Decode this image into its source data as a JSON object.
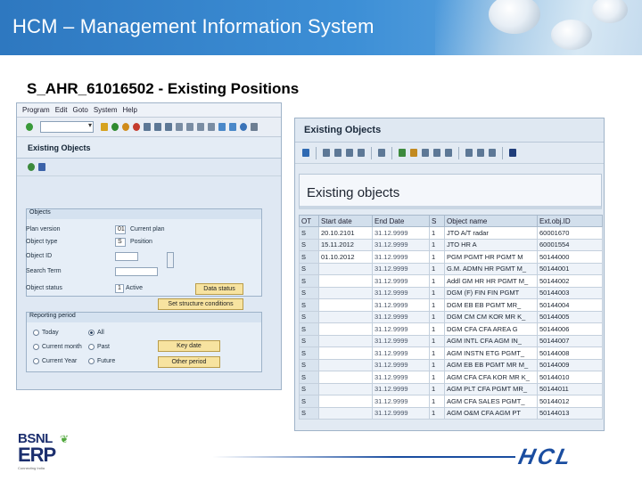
{
  "header": {
    "title": "HCM – Management Information System"
  },
  "slide": {
    "subtitle": "S_AHR_61016502 - Existing Positions"
  },
  "left_screen": {
    "menu": [
      "Program",
      "Edit",
      "Goto",
      "System",
      "Help"
    ],
    "title": "Existing Objects",
    "objects_group": "Objects",
    "fields": [
      {
        "label": "Plan version",
        "value": "01",
        "desc": "Current plan"
      },
      {
        "label": "Object type",
        "value": "S",
        "desc": "Position"
      },
      {
        "label": "Object ID",
        "value": "",
        "desc": ""
      },
      {
        "label": "Search Term",
        "value": "",
        "desc": ""
      },
      {
        "label": "Object status",
        "value": "1",
        "desc": "Active"
      }
    ],
    "data_status_btn": "Data status",
    "set_structure_btn": "Set structure conditions",
    "period_group": "Reporting period",
    "radios": [
      "Today",
      "All",
      "Current month",
      "Past",
      "Current Year",
      "Future"
    ],
    "key_date_btn": "Key date",
    "other_period_btn": "Other period"
  },
  "right_screen": {
    "title": "Existing Objects",
    "heading": "Existing objects",
    "columns": [
      "OT",
      "Start date",
      "End Date",
      "S",
      "Object name",
      "Ext.obj.ID"
    ],
    "rows": [
      [
        "S",
        "20.10.2101",
        "31.12.9999",
        "1",
        "JTO A/T radar",
        "60001670"
      ],
      [
        "S",
        "15.11.2012",
        "31.12.9999",
        "1",
        "JTO HR A",
        "60001554"
      ],
      [
        "S",
        "01.10.2012",
        "31.12.9999",
        "1",
        "PGM PGMT HR PGMT M",
        "50144000"
      ],
      [
        "S",
        "",
        "31.12.9999",
        "1",
        "G.M. ADMN HR PGMT M_",
        "50144001"
      ],
      [
        "S",
        "",
        "31.12.9999",
        "1",
        "Addl GM HR HR PGMT M_",
        "50144002"
      ],
      [
        "S",
        "",
        "31.12.9999",
        "1",
        "DGM (F) FIN FIN PGMT",
        "50144003"
      ],
      [
        "S",
        "",
        "31.12.9999",
        "1",
        "DGM EB EB PGMT MR_",
        "50144004"
      ],
      [
        "S",
        "",
        "31.12.9999",
        "1",
        "DGM CM CM KOR MR K_",
        "50144005"
      ],
      [
        "S",
        "",
        "31.12.9999",
        "1",
        "DGM CFA CFA AREA G",
        "50144006"
      ],
      [
        "S",
        "",
        "31.12.9999",
        "1",
        "AGM INTL CFA AGM IN_",
        "50144007"
      ],
      [
        "S",
        "",
        "31.12.9999",
        "1",
        "AGM INSTN ETG PGMT_",
        "50144008"
      ],
      [
        "S",
        "",
        "31.12.9999",
        "1",
        "AGM EB EB PGMT MR M_",
        "50144009"
      ],
      [
        "S",
        "",
        "31.12.9999",
        "1",
        "AGM CFA CFA KOR MR K_",
        "50144010"
      ],
      [
        "S",
        "",
        "31.12.9999",
        "1",
        "AGM PLT CFA PGMT MR_",
        "50144011"
      ],
      [
        "S",
        "",
        "31.12.9999",
        "1",
        "AGM CFA SALES PGMT_",
        "50144012"
      ],
      [
        "S",
        "",
        "31.12.9999",
        "1",
        "AGM O&M CFA AGM PT",
        "50144013"
      ]
    ]
  },
  "footer": {
    "bsnl": "BSNL",
    "erp": "ERP",
    "bsnl_tag": "Connecting India",
    "hcl": "HCL"
  },
  "colors": {
    "title_bar": "#2e78c0",
    "hcl_blue": "#1a4da0",
    "bsnl_navy": "#1c2f6e",
    "bsnl_green": "#53a93f"
  }
}
